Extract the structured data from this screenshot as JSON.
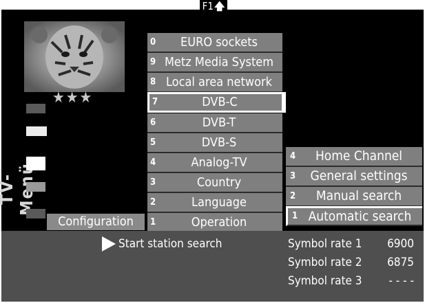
{
  "header": {
    "key_label": "F1",
    "icon": "arrow-up-icon"
  },
  "preview": {
    "stars": "★★★"
  },
  "side_title": "TV-Menü",
  "left_label": "Configuration",
  "middle_menu": [
    {
      "num": "0",
      "label": "EURO sockets"
    },
    {
      "num": "9",
      "label": "Metz Media System"
    },
    {
      "num": "8",
      "label": "Local area network"
    },
    {
      "num": "7",
      "label": "DVB-C"
    },
    {
      "num": "6",
      "label": "DVB-T"
    },
    {
      "num": "5",
      "label": "DVB-S"
    },
    {
      "num": "4",
      "label": "Analog-TV"
    },
    {
      "num": "3",
      "label": "Country"
    },
    {
      "num": "2",
      "label": "Language"
    },
    {
      "num": "1",
      "label": "Operation"
    }
  ],
  "right_menu": [
    {
      "num": "4",
      "label": "Home Channel"
    },
    {
      "num": "3",
      "label": "General settings"
    },
    {
      "num": "2",
      "label": "Manual search"
    },
    {
      "num": "1",
      "label": "Automatic search"
    }
  ],
  "info": {
    "action": "Start station search",
    "symbol_rates": [
      {
        "label": "Symbol rate 1",
        "value": "6900"
      },
      {
        "label": "Symbol rate 2",
        "value": "6875"
      },
      {
        "label": "Symbol rate 3",
        "value": "- - - -"
      }
    ]
  }
}
